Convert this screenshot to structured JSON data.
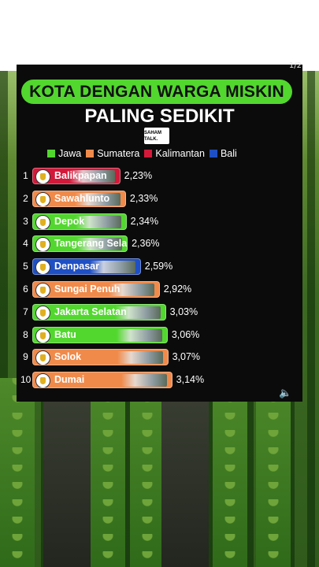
{
  "page": {
    "counter": "1/2"
  },
  "colors": {
    "Jawa": "#52d72f",
    "Sumatera": "#f08a4b",
    "Kalimantan": "#d3193a",
    "Bali": "#1f4fc4",
    "title_pill": "#52d72f"
  },
  "chart_data": {
    "type": "bar",
    "orientation": "horizontal",
    "title": "KOTA DENGAN WARGA MISKIN",
    "subtitle": "PALING SEDIKIT",
    "brand": "SAHAM TALK.",
    "legend": [
      "Jawa",
      "Sumatera",
      "Kalimantan",
      "Bali"
    ],
    "legend_position": "top",
    "grid": false,
    "xlim": [
      0,
      3.3
    ],
    "categories": [
      "Balikpapan",
      "Sawahlunto",
      "Depok",
      "Tangerang Selatan",
      "Denpasar",
      "Sungai Penuh",
      "Jakarta Selatan",
      "Batu",
      "Solok",
      "Dumai"
    ],
    "ranks": [
      "1",
      "2",
      "3",
      "4",
      "5",
      "6",
      "7",
      "8",
      "9",
      "10"
    ],
    "values": [
      2.23,
      2.33,
      2.34,
      2.36,
      2.59,
      2.92,
      3.03,
      3.06,
      3.07,
      3.14
    ],
    "value_labels": [
      "2,23%",
      "2,33%",
      "2,34%",
      "2,36%",
      "2,59%",
      "2,92%",
      "3,03%",
      "3,06%",
      "3,07%",
      "3,14%"
    ],
    "regions": [
      "Kalimantan",
      "Sumatera",
      "Jawa",
      "Jawa",
      "Bali",
      "Sumatera",
      "Jawa",
      "Jawa",
      "Sumatera",
      "Sumatera"
    ]
  }
}
